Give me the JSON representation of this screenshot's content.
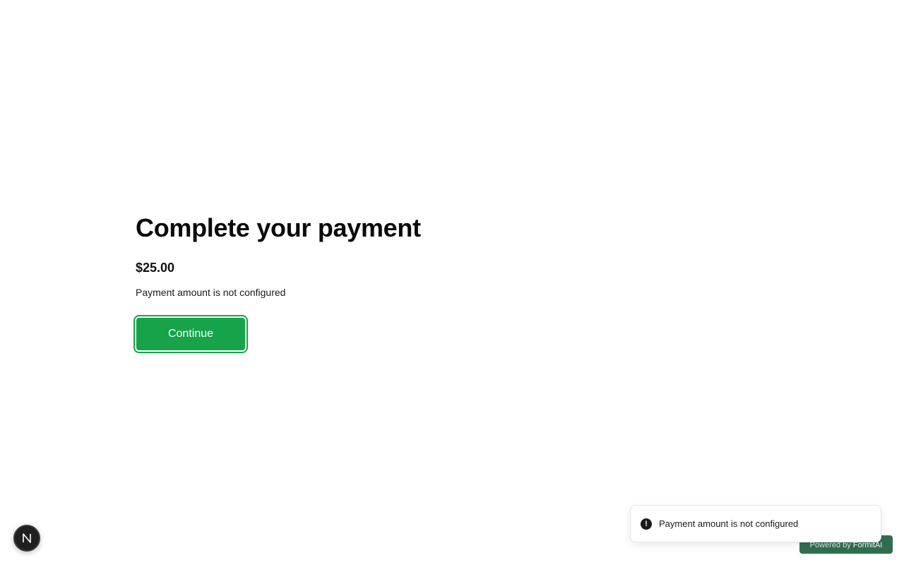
{
  "payment": {
    "title": "Complete your payment",
    "amount": "$25.00",
    "error_message": "Payment amount is not configured",
    "continue_label": "Continue"
  },
  "dev_badge": {
    "letter": "N",
    "icon": "nextjs-logo-icon"
  },
  "toast": {
    "icon": "alert-circle-icon",
    "icon_glyph": "!",
    "message": "Payment amount is not configured"
  },
  "footer": {
    "powered_prefix": "Powered by",
    "powered_brand": "FormitAI"
  },
  "colors": {
    "accent": "#16a34a",
    "powered_bg": "#2f6f4f"
  }
}
